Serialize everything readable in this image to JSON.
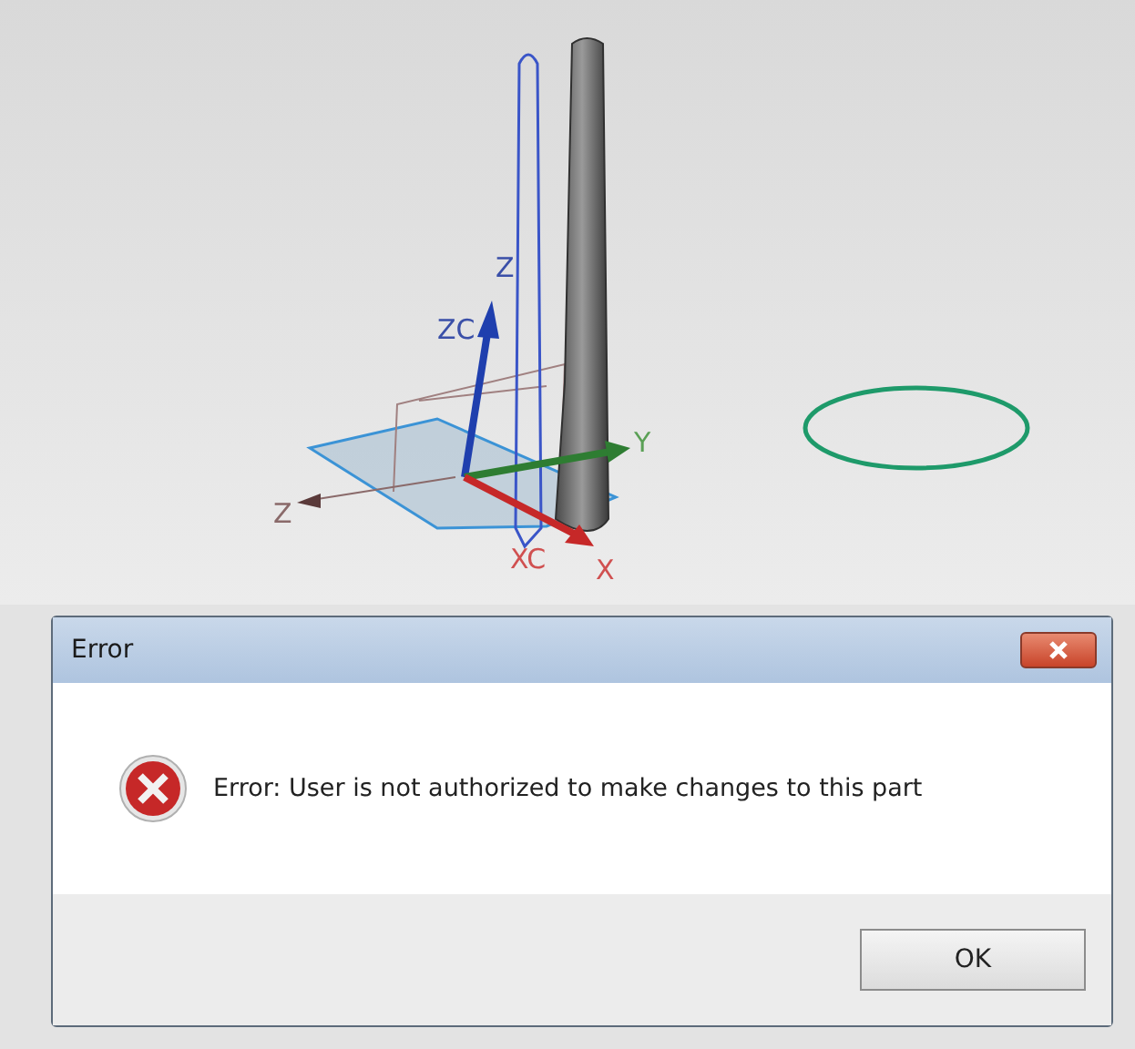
{
  "viewport": {
    "axis_labels": [
      "Z",
      "ZC",
      "Y",
      "Z",
      "XC",
      "X"
    ]
  },
  "dialog": {
    "title": "Error",
    "message": "Error: User is not authorized to make changes to this part",
    "buttons": [
      "OK"
    ]
  }
}
